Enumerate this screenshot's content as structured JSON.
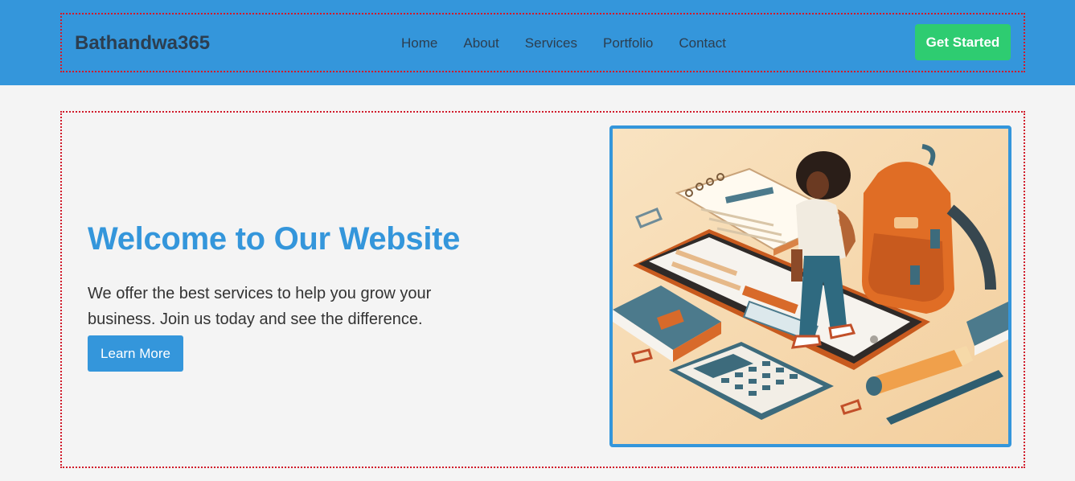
{
  "header": {
    "logo": "Bathandwa365",
    "nav": [
      {
        "label": "Home"
      },
      {
        "label": "About"
      },
      {
        "label": "Services"
      },
      {
        "label": "Portfolio"
      },
      {
        "label": "Contact"
      }
    ],
    "cta_label": "Get Started"
  },
  "hero": {
    "title": "Welcome to Our Website",
    "text": "We offer the best services to help you grow your business. Join us today and see the difference.",
    "button_label": "Learn More",
    "illustration": "student-with-phone-and-school-supplies-illustration"
  },
  "colors": {
    "primary": "#3496db",
    "accent": "#2ecc71",
    "dark": "#2c3e50",
    "background": "#f4f4f4",
    "debug_outline": "#d11a2a"
  }
}
